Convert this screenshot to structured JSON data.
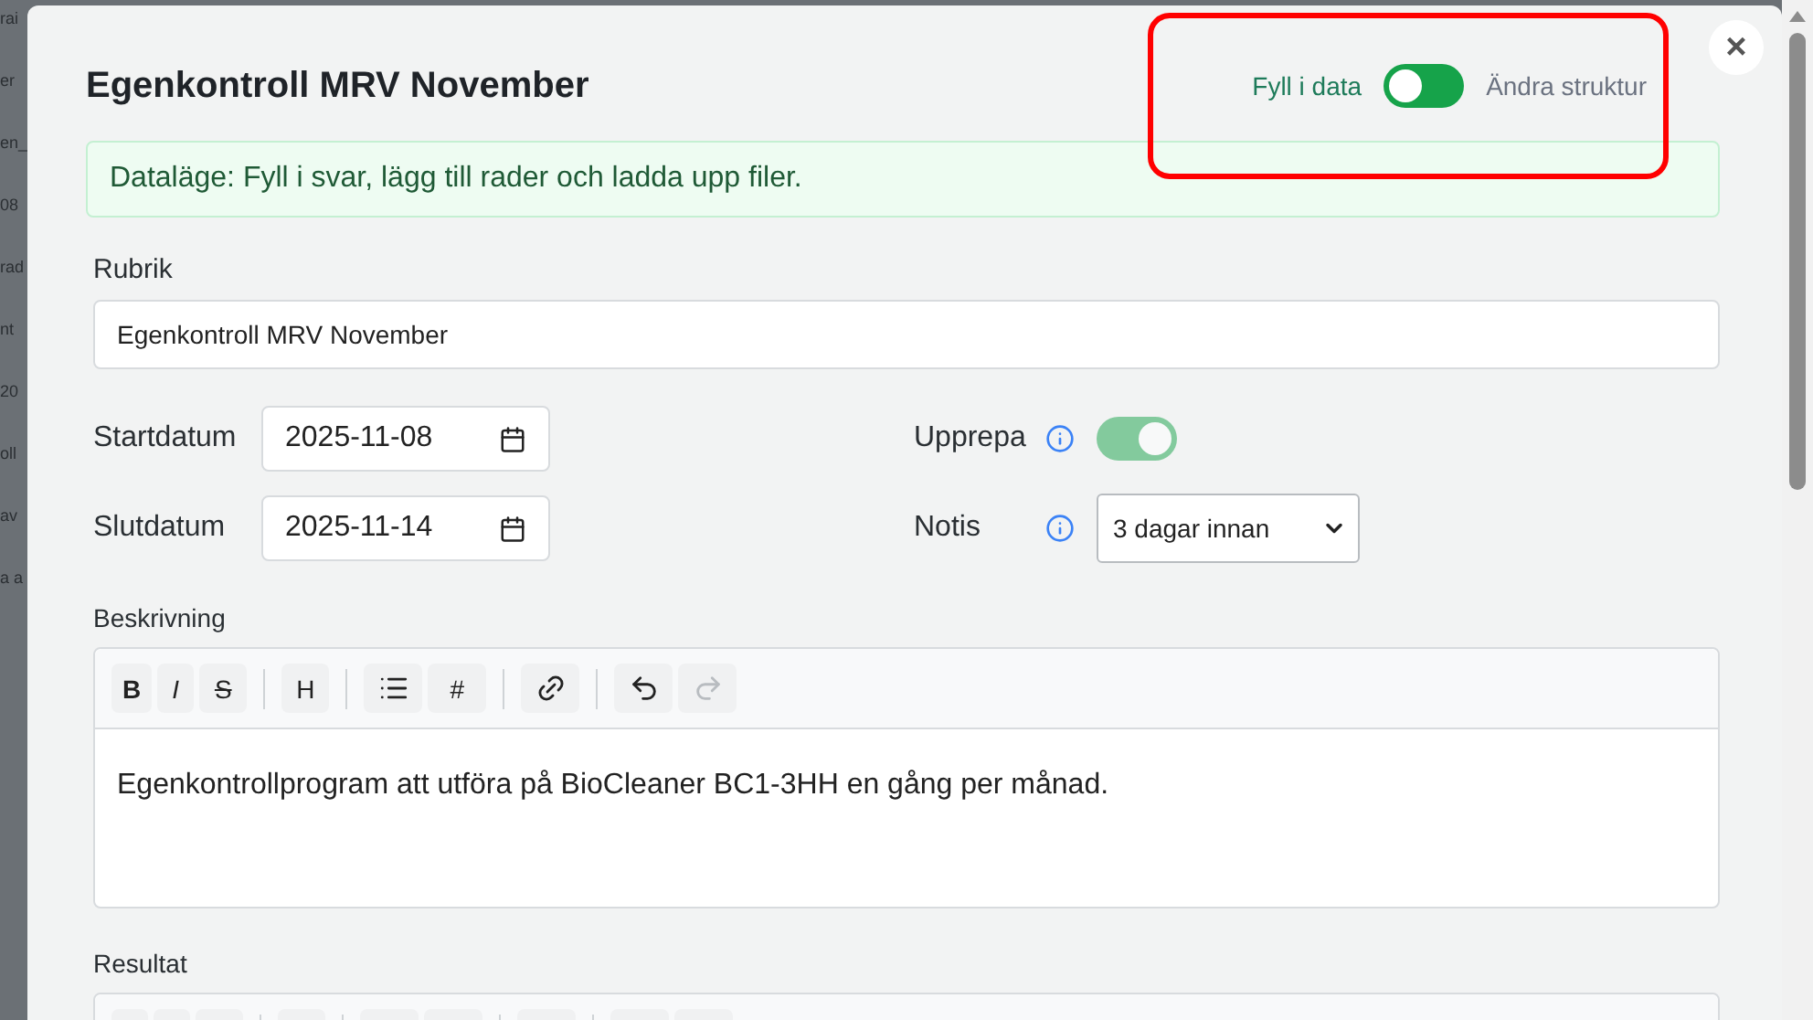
{
  "background_page": {
    "fragments": [
      "rai",
      "er",
      "en_",
      "08",
      "rad",
      "nt",
      "20",
      "oll",
      "av",
      "a a"
    ]
  },
  "dialog": {
    "title": "Egenkontroll MRV November",
    "close": "×",
    "mode_switch": {
      "left_label": "Fyll i data",
      "right_label": "Ändra struktur",
      "structure_mode": false
    },
    "banner": "Dataläge: Fyll i svar, lägg till rader och ladda upp filer.",
    "rubrik": {
      "label": "Rubrik",
      "value": "Egenkontroll MRV November"
    },
    "start": {
      "label": "Startdatum",
      "value": "2025-11-08"
    },
    "end": {
      "label": "Slutdatum",
      "value": "2025-11-14"
    },
    "repeat": {
      "label": "Upprepa",
      "on": true,
      "disabled": true
    },
    "notice": {
      "label": "Notis",
      "value": "3 dagar innan"
    },
    "description": {
      "label": "Beskrivning",
      "text": "Egenkontrollprogram att utföra på BioCleaner BC1-3HH en gång per månad.",
      "toolbar": [
        {
          "kind": "bold",
          "text": "B",
          "disabled": false
        },
        {
          "kind": "italic",
          "text": "I",
          "disabled": false
        },
        {
          "kind": "strike",
          "text": "S",
          "disabled": false
        },
        {
          "kind": "divider"
        },
        {
          "kind": "heading",
          "text": "H",
          "disabled": false
        },
        {
          "kind": "divider"
        },
        {
          "kind": "list",
          "disabled": false
        },
        {
          "kind": "numbered",
          "text": "#",
          "disabled": false
        },
        {
          "kind": "divider"
        },
        {
          "kind": "link",
          "disabled": false
        },
        {
          "kind": "divider"
        },
        {
          "kind": "undo",
          "disabled": false
        },
        {
          "kind": "redo",
          "disabled": true
        }
      ]
    },
    "result": {
      "label": "Resultat"
    }
  },
  "annotation": {
    "shown": true
  }
}
